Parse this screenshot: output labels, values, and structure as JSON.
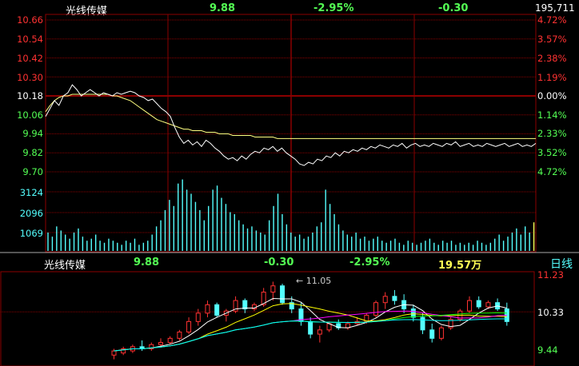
{
  "colors": {
    "up": "#ff3232",
    "down": "#54ffff",
    "neutral": "#ffffff",
    "green": "#54ff54",
    "price_line": "#ffffff",
    "avg_line": "#ffff80",
    "grid": "#8b0000",
    "volume": "#54ffff",
    "ma5": "#ffffff",
    "ma10": "#ffff00",
    "ma20": "#ff00ff",
    "ma30": "#00ff00",
    "ma60": "#00ffff"
  },
  "intraday": {
    "name": "光线传媒",
    "price": "9.88",
    "change_pct": "-2.95%",
    "change": "-0.30",
    "volume_total": "195,711",
    "price_ticks": [
      "10.66",
      "10.54",
      "10.42",
      "10.30",
      "10.18",
      "10.06",
      "9.94",
      "9.82",
      "9.70"
    ],
    "pct_ticks": [
      "4.72%",
      "3.57%",
      "2.38%",
      "1.19%",
      "0.00%",
      "1.14%",
      "2.33%",
      "3.52%",
      "4.72%"
    ],
    "volume_ticks": [
      "3124",
      "2096",
      "1069"
    ],
    "price_series": [
      10.05,
      10.1,
      10.15,
      10.12,
      10.18,
      10.2,
      10.25,
      10.22,
      10.18,
      10.2,
      10.22,
      10.2,
      10.18,
      10.2,
      10.19,
      10.18,
      10.2,
      10.19,
      10.2,
      10.21,
      10.2,
      10.18,
      10.17,
      10.15,
      10.16,
      10.13,
      10.1,
      10.08,
      10.05,
      9.98,
      9.92,
      9.88,
      9.9,
      9.87,
      9.89,
      9.86,
      9.9,
      9.88,
      9.85,
      9.83,
      9.8,
      9.78,
      9.79,
      9.77,
      9.8,
      9.78,
      9.81,
      9.83,
      9.82,
      9.85,
      9.84,
      9.86,
      9.83,
      9.85,
      9.82,
      9.8,
      9.78,
      9.75,
      9.74,
      9.76,
      9.75,
      9.78,
      9.77,
      9.8,
      9.79,
      9.82,
      9.8,
      9.83,
      9.82,
      9.84,
      9.83,
      9.85,
      9.84,
      9.86,
      9.85,
      9.87,
      9.86,
      9.85,
      9.87,
      9.86,
      9.88,
      9.85,
      9.87,
      9.88,
      9.86,
      9.87,
      9.86,
      9.88,
      9.87,
      9.86,
      9.88,
      9.87,
      9.89,
      9.86,
      9.87,
      9.88,
      9.86,
      9.87,
      9.86,
      9.88,
      9.87,
      9.86,
      9.87,
      9.88,
      9.86,
      9.87,
      9.88,
      9.86,
      9.87,
      9.86,
      9.88
    ],
    "avg_series": [
      10.08,
      10.12,
      10.15,
      10.17,
      10.18,
      10.18,
      10.19,
      10.19,
      10.19,
      10.19,
      10.19,
      10.19,
      10.19,
      10.19,
      10.19,
      10.18,
      10.18,
      10.17,
      10.16,
      10.15,
      10.13,
      10.11,
      10.09,
      10.07,
      10.05,
      10.03,
      10.02,
      10.01,
      10.0,
      9.99,
      9.98,
      9.97,
      9.97,
      9.96,
      9.96,
      9.96,
      9.95,
      9.95,
      9.95,
      9.94,
      9.94,
      9.94,
      9.93,
      9.93,
      9.93,
      9.93,
      9.93,
      9.92,
      9.92,
      9.92,
      9.92,
      9.92,
      9.91,
      9.91,
      9.91,
      9.91,
      9.91,
      9.91,
      9.91,
      9.91,
      9.91,
      9.91,
      9.91,
      9.91,
      9.91,
      9.91,
      9.91,
      9.91,
      9.91,
      9.91,
      9.91,
      9.91,
      9.91,
      9.91,
      9.91,
      9.91,
      9.91,
      9.91,
      9.91,
      9.91,
      9.91,
      9.91,
      9.91,
      9.91,
      9.91,
      9.91,
      9.91,
      9.91,
      9.91,
      9.91,
      9.91,
      9.91,
      9.91,
      9.91,
      9.91,
      9.91,
      9.91,
      9.91,
      9.91,
      9.91,
      9.91,
      9.91,
      9.91,
      9.91,
      9.91,
      9.91,
      9.91,
      9.91,
      9.91,
      9.91,
      9.91
    ],
    "volumes": [
      900,
      700,
      1200,
      1000,
      800,
      600,
      900,
      1100,
      700,
      500,
      600,
      800,
      500,
      400,
      600,
      500,
      400,
      300,
      500,
      400,
      600,
      300,
      400,
      500,
      800,
      1200,
      1500,
      2000,
      2500,
      2200,
      3300,
      3500,
      3000,
      2800,
      2400,
      2000,
      1500,
      2200,
      3000,
      3200,
      2600,
      2300,
      1900,
      1800,
      1500,
      1300,
      1100,
      1200,
      1000,
      900,
      800,
      1500,
      2200,
      2800,
      1800,
      1300,
      900,
      700,
      800,
      600,
      700,
      900,
      1200,
      1400,
      3000,
      2300,
      1800,
      1300,
      1000,
      800,
      700,
      900,
      600,
      700,
      500,
      600,
      700,
      500,
      400,
      500,
      600,
      400,
      300,
      500,
      400,
      300,
      400,
      500,
      600,
      400,
      300,
      500,
      400,
      500,
      300,
      400,
      300,
      400,
      300,
      500,
      400,
      300,
      400,
      600,
      800,
      500,
      700,
      900,
      1100,
      800,
      1200,
      900,
      1400
    ]
  },
  "kline": {
    "name": "光线传媒",
    "price": "9.88",
    "change": "-0.30",
    "change_pct": "-2.95%",
    "volume": "19.57万",
    "period": "日线",
    "high_label": "11.05",
    "price_ticks": [
      "11.23",
      "10.33",
      "9.44"
    ],
    "candles": [
      [
        9.3,
        9.45,
        9.2,
        9.4
      ],
      [
        9.35,
        9.5,
        9.3,
        9.45
      ],
      [
        9.4,
        9.55,
        9.35,
        9.5
      ],
      [
        9.5,
        9.65,
        9.4,
        9.45
      ],
      [
        9.45,
        9.6,
        9.4,
        9.55
      ],
      [
        9.55,
        9.7,
        9.5,
        9.6
      ],
      [
        9.6,
        9.75,
        9.55,
        9.7
      ],
      [
        9.7,
        9.9,
        9.65,
        9.85
      ],
      [
        9.85,
        10.2,
        9.8,
        10.1
      ],
      [
        10.1,
        10.4,
        10.0,
        10.3
      ],
      [
        10.3,
        10.6,
        10.2,
        10.5
      ],
      [
        10.5,
        10.55,
        10.2,
        10.25
      ],
      [
        10.25,
        10.4,
        10.1,
        10.35
      ],
      [
        10.35,
        10.7,
        10.3,
        10.6
      ],
      [
        10.6,
        10.65,
        10.3,
        10.4
      ],
      [
        10.4,
        10.55,
        10.35,
        10.5
      ],
      [
        10.5,
        10.9,
        10.45,
        10.8
      ],
      [
        10.8,
        11.05,
        10.6,
        10.95
      ],
      [
        10.95,
        11.0,
        10.5,
        10.55
      ],
      [
        10.55,
        10.7,
        10.3,
        10.4
      ],
      [
        10.4,
        10.55,
        10.0,
        10.1
      ],
      [
        10.1,
        10.2,
        9.7,
        9.8
      ],
      [
        9.8,
        10.0,
        9.6,
        9.9
      ],
      [
        9.9,
        10.1,
        9.85,
        10.05
      ],
      [
        10.05,
        10.15,
        9.9,
        9.95
      ],
      [
        9.95,
        10.1,
        9.9,
        10.05
      ],
      [
        10.05,
        10.2,
        10.0,
        10.1
      ],
      [
        10.1,
        10.3,
        10.05,
        10.25
      ],
      [
        10.25,
        10.6,
        10.2,
        10.55
      ],
      [
        10.55,
        10.8,
        10.4,
        10.7
      ],
      [
        10.7,
        10.85,
        10.5,
        10.6
      ],
      [
        10.6,
        10.75,
        10.3,
        10.4
      ],
      [
        10.4,
        10.5,
        10.1,
        10.2
      ],
      [
        10.2,
        10.3,
        9.8,
        9.9
      ],
      [
        9.9,
        10.05,
        9.6,
        9.7
      ],
      [
        9.7,
        10.0,
        9.65,
        9.95
      ],
      [
        9.95,
        10.2,
        9.9,
        10.15
      ],
      [
        10.15,
        10.4,
        10.1,
        10.35
      ],
      [
        10.35,
        10.7,
        10.3,
        10.6
      ],
      [
        10.6,
        10.7,
        10.4,
        10.45
      ],
      [
        10.45,
        10.6,
        10.4,
        10.55
      ],
      [
        10.55,
        10.65,
        10.35,
        10.4
      ],
      [
        10.4,
        10.55,
        10.0,
        10.1
      ]
    ]
  }
}
